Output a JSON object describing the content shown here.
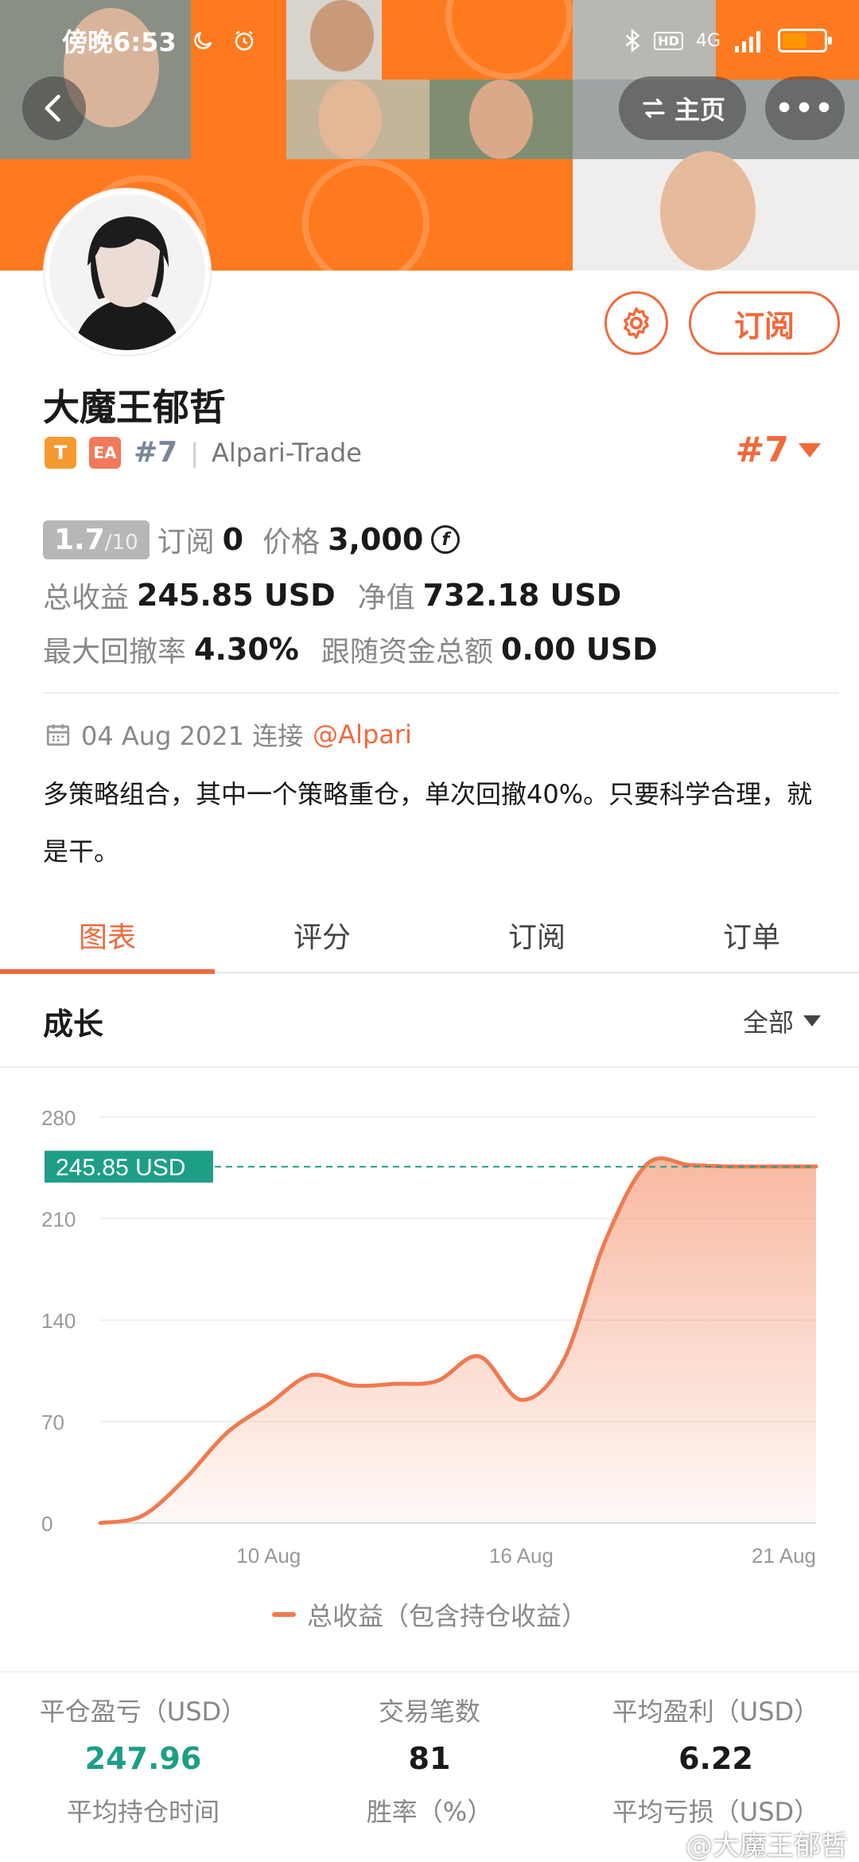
{
  "status": {
    "time": "傍晚6:53",
    "network": "4G"
  },
  "nav": {
    "home_label": "主页",
    "more_label": "•••"
  },
  "profile": {
    "name": "大魔王郁哲",
    "tag_t": "T",
    "tag_ea": "EA",
    "rank": "#7",
    "broker": "Alpari-Trade",
    "rank_right": "#7",
    "subscribe_label": "订阅"
  },
  "stats": {
    "score": "1.7",
    "score_max": "/10",
    "subs_label": "订阅",
    "subs_value": "0",
    "price_label": "价格",
    "price_value": "3,000",
    "coin_symbol": "f",
    "total_profit_label": "总收益",
    "total_profit_value": "245.85 USD",
    "equity_label": "净值",
    "equity_value": "732.18 USD",
    "drawdown_label": "最大回撤率",
    "drawdown_value": "4.30%",
    "follow_label": "跟随资金总额",
    "follow_value": "0.00 USD"
  },
  "connect": {
    "date": "04 Aug 2021 连接",
    "link": "@Alpari"
  },
  "description": "多策略组合，其中一个策略重仓，单次回撤40%。只要科学合理，就是干。",
  "tabs": [
    {
      "label": "图表"
    },
    {
      "label": "评分"
    },
    {
      "label": "订阅"
    },
    {
      "label": "订单"
    }
  ],
  "section": {
    "title": "成长",
    "filter": "全部"
  },
  "chart_data": {
    "type": "area",
    "ylim": [
      0,
      280
    ],
    "y_ticks": [
      "280",
      "210",
      "140",
      "70",
      "0"
    ],
    "x_tick_labels": [
      "10 Aug",
      "16 Aug",
      "21 Aug"
    ],
    "current_label": "245.85 USD",
    "current_value": 245.85,
    "series": [
      {
        "name": "总收益（包含持仓收益）",
        "x": [
          5,
          6,
          7,
          8,
          9,
          10,
          11,
          12,
          13,
          14,
          15,
          16,
          17,
          18,
          19,
          20,
          21,
          22
        ],
        "values": [
          0,
          5,
          30,
          62,
          82,
          102,
          95,
          96,
          98,
          115,
          85,
          112,
          195,
          248,
          247,
          246,
          246,
          246
        ]
      }
    ],
    "color": "#f07a50"
  },
  "metrics": [
    {
      "label": "平仓盈亏（USD）",
      "value": "247.96",
      "color": "#1e9e86"
    },
    {
      "label": "交易笔数",
      "value": "81"
    },
    {
      "label": "平均盈利（USD）",
      "value": "6.22"
    },
    {
      "label": "平均持仓时间",
      "value": ""
    },
    {
      "label": "胜率（%）",
      "value": ""
    },
    {
      "label": "平均亏损（USD）",
      "value": ""
    }
  ],
  "watermark": "@大魔王郁哲"
}
